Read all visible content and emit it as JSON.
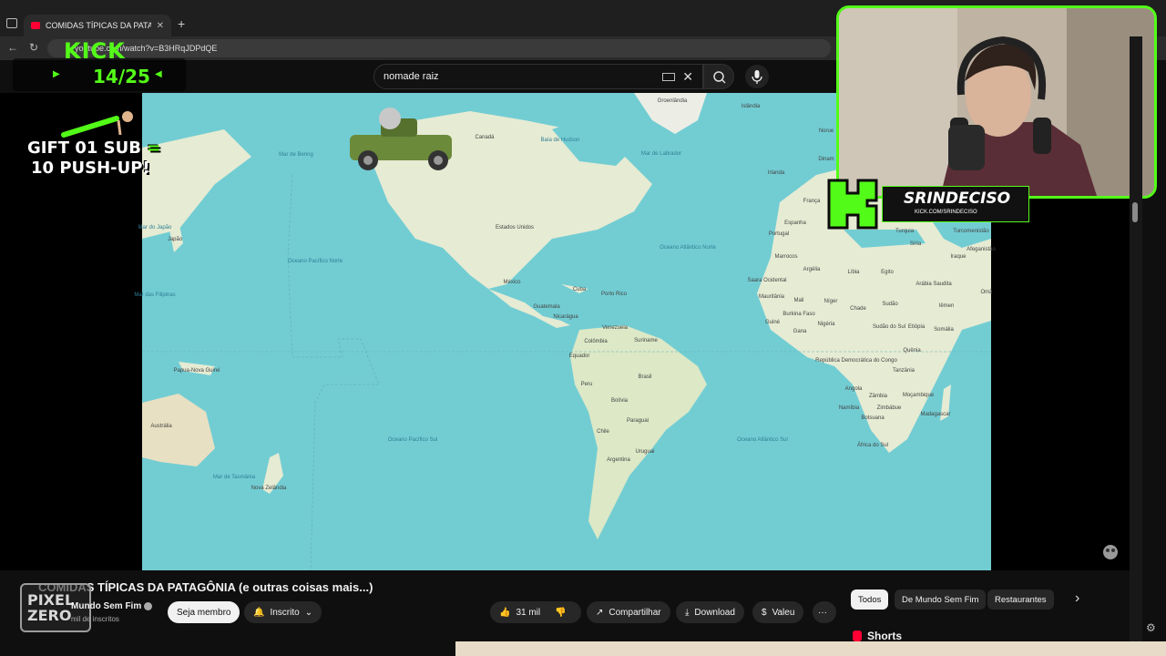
{
  "browser": {
    "tab_title": "COMIDAS TÍPICAS DA PATAGÔ",
    "tab_close": "✕",
    "new_tab": "+",
    "url": "youtube.com/watch?v=B3HRqJDPdQE",
    "back": "←",
    "reload": "↻"
  },
  "youtube": {
    "search_query": "nomade raiz",
    "search_clear": "✕",
    "search_glyph": "⌕",
    "mic_glyph": "🎙"
  },
  "overlay": {
    "kick_logo": "KICK",
    "sub_counter": "14/25",
    "gift_line1": "GIFT 01 SUB",
    "gift_equals": "=",
    "gift_line2": "10 PUSH-UP!",
    "channel_name": "SRINDECISO",
    "channel_url": "KICK.COM/SRINDECISO",
    "watermark_text": "PIXEL ZERO"
  },
  "map": {
    "countries": [
      {
        "name": "Groenlândia"
      },
      {
        "name": "Islândia"
      },
      {
        "name": "Canadá"
      },
      {
        "name": "Baía de Hudson"
      },
      {
        "name": "Mar de Labrador"
      },
      {
        "name": "Mar de Bering"
      },
      {
        "name": "Estados Unidos"
      },
      {
        "name": "México"
      },
      {
        "name": "Cuba"
      },
      {
        "name": "Porto Rico"
      },
      {
        "name": "Guatemala"
      },
      {
        "name": "Nicarágua"
      },
      {
        "name": "Venezuela"
      },
      {
        "name": "Colômbia"
      },
      {
        "name": "Suriname"
      },
      {
        "name": "Equador"
      },
      {
        "name": "Peru"
      },
      {
        "name": "Brasil"
      },
      {
        "name": "Bolívia"
      },
      {
        "name": "Paraguai"
      },
      {
        "name": "Chile"
      },
      {
        "name": "Uruguai"
      },
      {
        "name": "Argentina"
      },
      {
        "name": "Japão"
      },
      {
        "name": "Mar do Japão"
      },
      {
        "name": "Mar das Filipinas"
      },
      {
        "name": "Papua-Nova Guiné"
      },
      {
        "name": "Austrália"
      },
      {
        "name": "Mar de Tasmânia"
      },
      {
        "name": "Nova Zelândia"
      },
      {
        "name": "Irlanda"
      },
      {
        "name": "França"
      },
      {
        "name": "Espanha"
      },
      {
        "name": "Portugal"
      },
      {
        "name": "Turquia"
      },
      {
        "name": "Síria"
      },
      {
        "name": "Turcomenistão"
      },
      {
        "name": "Afeganistão"
      },
      {
        "name": "Iraque"
      },
      {
        "name": "Marrocos"
      },
      {
        "name": "Argélia"
      },
      {
        "name": "Líbia"
      },
      {
        "name": "Egito"
      },
      {
        "name": "Arábia Saudita"
      },
      {
        "name": "Omã"
      },
      {
        "name": "Iêmen"
      },
      {
        "name": "Saara Ocidental"
      },
      {
        "name": "Mauritânia"
      },
      {
        "name": "Mali"
      },
      {
        "name": "Níger"
      },
      {
        "name": "Chade"
      },
      {
        "name": "Sudão"
      },
      {
        "name": "Sudão do Sul"
      },
      {
        "name": "Etiópia"
      },
      {
        "name": "Burkina Faso"
      },
      {
        "name": "Guiné"
      },
      {
        "name": "Gana"
      },
      {
        "name": "Nigéria"
      },
      {
        "name": "Somália"
      },
      {
        "name": "Quênia"
      },
      {
        "name": "República Democrática do Congo"
      },
      {
        "name": "Tanzânia"
      },
      {
        "name": "Angola"
      },
      {
        "name": "Zâmbia"
      },
      {
        "name": "Moçambique"
      },
      {
        "name": "Namíbia"
      },
      {
        "name": "Zimbábue"
      },
      {
        "name": "Botsuana"
      },
      {
        "name": "Madagascar"
      },
      {
        "name": "África do Sul"
      },
      {
        "name": "Dinam"
      },
      {
        "name": "Norue"
      }
    ],
    "oceans": [
      {
        "name": "Oceano Pacífico Norte"
      },
      {
        "name": "Oceano Atlântico Norte"
      },
      {
        "name": "Oceano Pacífico Sul"
      },
      {
        "name": "Oceano Atlântico Sul"
      }
    ]
  },
  "video": {
    "title": "COMIDAS TÍPICAS DA PATAGÔNIA (e outras coisas mais...)",
    "channel": "Mundo Sem Fim",
    "subscribers": "mil de inscritos",
    "join_label": "Seja membro",
    "subscribed_label": "Inscrito",
    "likes": "31 mil",
    "share_label": "Compartilhar",
    "download_label": "Download",
    "thanks_label": "Valeu",
    "more_label": "···"
  },
  "chips": [
    {
      "label": "Todos",
      "active": true
    },
    {
      "label": "De Mundo Sem Fim",
      "active": false
    },
    {
      "label": "Restaurantes",
      "active": false
    }
  ],
  "chips_next": "›",
  "shorts_label": "Shorts",
  "colors": {
    "kick_green": "#53fc18",
    "ocean": "#72cdd3",
    "land": "#e9ecd9",
    "youtube_red": "#ff0033"
  }
}
